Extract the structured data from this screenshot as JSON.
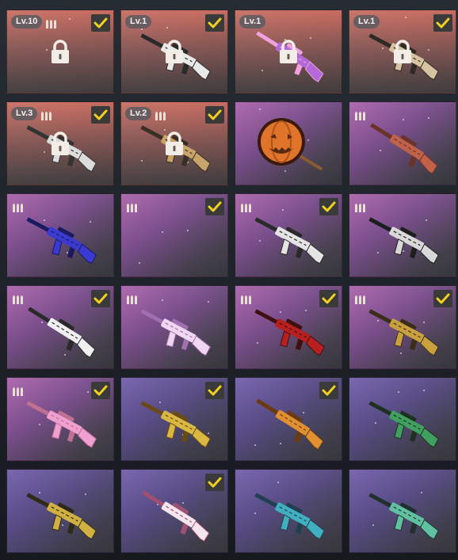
{
  "inventory": {
    "items": [
      {
        "bg": "orange",
        "level": "Lv.10",
        "ammo": true,
        "checked": true,
        "locked": true,
        "icon": "none",
        "colors": [
          "#e8e8e8",
          "#222222"
        ]
      },
      {
        "bg": "orange",
        "level": "Lv.1",
        "ammo": false,
        "checked": true,
        "locked": true,
        "icon": "rifle-white-camo",
        "colors": [
          "#e8e8e8",
          "#2a2a2a"
        ]
      },
      {
        "bg": "orange",
        "level": "Lv.1",
        "ammo": false,
        "checked": false,
        "locked": true,
        "icon": "sniper-purple",
        "colors": [
          "#b36ad8",
          "#f2a1e0"
        ]
      },
      {
        "bg": "orange",
        "level": "Lv.1",
        "ammo": false,
        "checked": true,
        "locked": true,
        "icon": "rifle-tan",
        "colors": [
          "#d8c3a0",
          "#2e2a26"
        ]
      },
      {
        "bg": "orange",
        "level": "Lv.3",
        "ammo": true,
        "checked": true,
        "locked": true,
        "icon": "grenade-launcher",
        "colors": [
          "#dcdcdc",
          "#333333"
        ]
      },
      {
        "bg": "orange",
        "level": "Lv.2",
        "ammo": true,
        "checked": true,
        "locked": true,
        "icon": "shotgun-gold",
        "colors": [
          "#c9a46a",
          "#3a2f25"
        ]
      },
      {
        "bg": "purple",
        "level": "",
        "ammo": false,
        "checked": false,
        "locked": false,
        "icon": "pumpkin-pan",
        "colors": [
          "#e0742a",
          "#5a2a10"
        ]
      },
      {
        "bg": "purple",
        "level": "",
        "ammo": true,
        "checked": false,
        "locked": false,
        "icon": "rifle-copper",
        "colors": [
          "#c0614a",
          "#6b3228"
        ]
      },
      {
        "bg": "purple",
        "level": "",
        "ammo": true,
        "checked": false,
        "locked": false,
        "icon": "ak-blue-galaxy",
        "colors": [
          "#3a3ad0",
          "#1a1a60"
        ]
      },
      {
        "bg": "purple",
        "level": "",
        "ammo": true,
        "checked": true,
        "locked": false,
        "icon": "none",
        "colors": [
          "#ffffff",
          "#ffffff"
        ]
      },
      {
        "bg": "purple",
        "level": "",
        "ammo": true,
        "checked": true,
        "locked": false,
        "icon": "m4-white",
        "colors": [
          "#e4e4e4",
          "#2a2a2a"
        ]
      },
      {
        "bg": "purple",
        "level": "",
        "ammo": true,
        "checked": false,
        "locked": false,
        "icon": "m4-bw",
        "colors": [
          "#d8d8d8",
          "#1e1e1e"
        ]
      },
      {
        "bg": "purple",
        "level": "",
        "ammo": true,
        "checked": true,
        "locked": false,
        "icon": "sniper-white",
        "colors": [
          "#f0f0f0",
          "#2a2a2a"
        ]
      },
      {
        "bg": "purple",
        "level": "",
        "ammo": true,
        "checked": false,
        "locked": false,
        "icon": "ak-pink-white",
        "colors": [
          "#f0d6f0",
          "#a070b0"
        ]
      },
      {
        "bg": "purple",
        "level": "",
        "ammo": true,
        "checked": true,
        "locked": false,
        "icon": "m16-red",
        "colors": [
          "#b82020",
          "#401010"
        ]
      },
      {
        "bg": "purple",
        "level": "",
        "ammo": true,
        "checked": true,
        "locked": false,
        "icon": "rifle-gold",
        "colors": [
          "#c8a040",
          "#3a2e18"
        ]
      },
      {
        "bg": "purple",
        "level": "",
        "ammo": true,
        "checked": true,
        "locked": false,
        "icon": "rifle-pink",
        "colors": [
          "#f0a0d0",
          "#c07090"
        ]
      },
      {
        "bg": "violet",
        "level": "",
        "ammo": false,
        "checked": true,
        "locked": false,
        "icon": "groza-gold",
        "colors": [
          "#d8b840",
          "#6a4a18"
        ]
      },
      {
        "bg": "violet",
        "level": "",
        "ammo": false,
        "checked": true,
        "locked": false,
        "icon": "shotgun-orange",
        "colors": [
          "#e09030",
          "#6a3a10"
        ]
      },
      {
        "bg": "violet",
        "level": "",
        "ammo": false,
        "checked": false,
        "locked": false,
        "icon": "ak-green-camo",
        "colors": [
          "#40a060",
          "#203020"
        ]
      },
      {
        "bg": "violet",
        "level": "",
        "ammo": false,
        "checked": false,
        "locked": false,
        "icon": "ak-leopard",
        "colors": [
          "#d0b040",
          "#302818"
        ]
      },
      {
        "bg": "violet",
        "level": "",
        "ammo": false,
        "checked": true,
        "locked": false,
        "icon": "sniper-pink-white",
        "colors": [
          "#f4e6ec",
          "#a05070"
        ]
      },
      {
        "bg": "violet",
        "level": "",
        "ammo": false,
        "checked": false,
        "locked": false,
        "icon": "ak-cyan",
        "colors": [
          "#40b0c0",
          "#204050"
        ]
      },
      {
        "bg": "violet",
        "level": "",
        "ammo": false,
        "checked": false,
        "locked": false,
        "icon": "ak-teal-camo",
        "colors": [
          "#60c0a0",
          "#203030"
        ]
      }
    ]
  },
  "colors": {
    "check": "#f0d020",
    "lock": "#f2ede6",
    "ammo": "#e8e2d6"
  }
}
